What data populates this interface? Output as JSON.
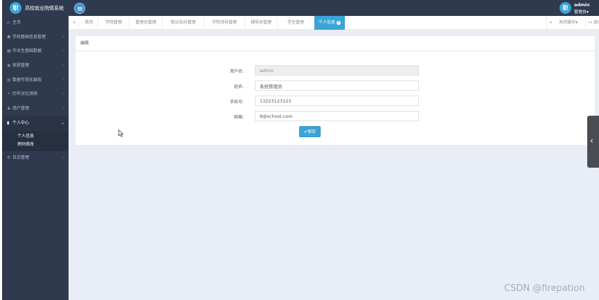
{
  "header": {
    "logo_text": "职",
    "title": "高校就业院情系统",
    "user_avatar_text": "职",
    "user_name": "admin",
    "user_role": "管理员▾"
  },
  "sidebar": {
    "items": [
      {
        "icon": "home-icon",
        "glyph": "⌂",
        "label": "主页",
        "chevron": ""
      },
      {
        "icon": "building-icon",
        "glyph": "☗",
        "label": "学校基础信息管理",
        "chevron": "‹"
      },
      {
        "icon": "database-icon",
        "glyph": "▦",
        "label": "毕业生基础数据",
        "chevron": "‹"
      },
      {
        "icon": "eye-icon",
        "glyph": "◉",
        "label": "就程管理",
        "chevron": "‹"
      },
      {
        "icon": "document-icon",
        "glyph": "▤",
        "label": "数据可视化展现",
        "chevron": "‹"
      },
      {
        "icon": "chart-icon",
        "glyph": "↗",
        "label": "历年对比预测",
        "chevron": "‹"
      },
      {
        "icon": "user-icon",
        "glyph": "♟",
        "label": "用户管理",
        "chevron": "‹"
      },
      {
        "icon": "id-card-icon",
        "glyph": "▮",
        "label": "个人中心",
        "chevron": "⌄"
      }
    ],
    "submenu": [
      "个人信息",
      "密码修改"
    ],
    "after": {
      "icon": "settings-icon",
      "glyph": "⚙",
      "label": "日志管理",
      "chevron": "‹"
    }
  },
  "tabs": {
    "prev": "«",
    "items": [
      "首页",
      "学院管理",
      "管理员管理",
      "就业去向管理",
      "学院领导管理",
      "辅导员管理",
      "学生管理",
      "个人信息"
    ],
    "active_index": 7,
    "close_glyph": "×",
    "next": "»",
    "ops": "关闭操作▾",
    "return": "↦ 退出"
  },
  "panel": {
    "heading": "编辑",
    "fields": [
      {
        "label": "用户名:",
        "value": "admin",
        "readonly": true
      },
      {
        "label": "姓名:",
        "value": "系统管理员",
        "readonly": false
      },
      {
        "label": "手机号:",
        "value": "13223123123",
        "readonly": false
      },
      {
        "label": "邮箱:",
        "value": "8@school.com",
        "readonly": false
      }
    ],
    "save_label": "✔保存"
  },
  "drawer_handle_glyph": "‹",
  "watermark": "CSDN @firepation",
  "colors": {
    "sidebar": "#2f3a4f",
    "accent": "#3aa4d8",
    "background": "#e9edf5"
  }
}
